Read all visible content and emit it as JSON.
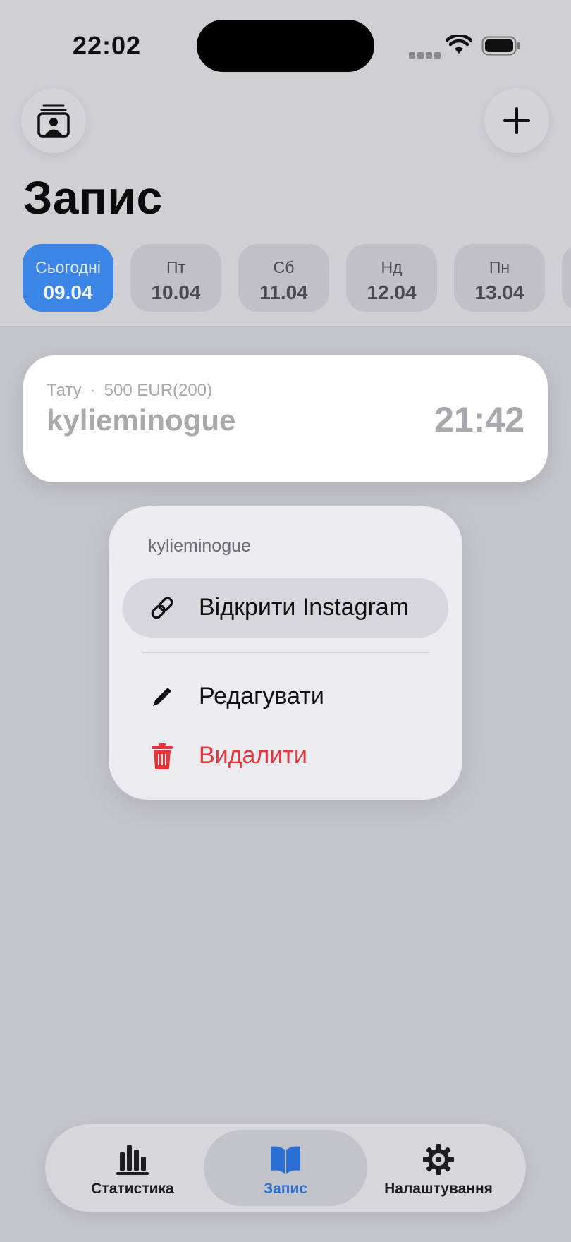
{
  "status_bar": {
    "time": "22:02"
  },
  "header": {
    "title": "Запис",
    "icons": [
      "contacts-icon",
      "plus-icon"
    ]
  },
  "date_chips": [
    {
      "name": "Сьогодні",
      "date": "09.04",
      "active": true
    },
    {
      "name": "Пт",
      "date": "10.04",
      "active": false
    },
    {
      "name": "Сб",
      "date": "11.04",
      "active": false
    },
    {
      "name": "Нд",
      "date": "12.04",
      "active": false
    },
    {
      "name": "Пн",
      "date": "13.04",
      "active": false
    }
  ],
  "entry": {
    "service": "Тату",
    "separator": "·",
    "price": "500 EUR(200)",
    "client": "kylieminogue",
    "time": "21:42"
  },
  "context_menu": {
    "title": "kylieminogue",
    "items": [
      {
        "label": "Відкрити Instagram",
        "icon": "link-icon"
      },
      {
        "label": "Редагувати",
        "icon": "pencil-icon"
      },
      {
        "label": "Видалити",
        "icon": "trash-icon"
      }
    ]
  },
  "tab_bar": {
    "items": [
      {
        "label": "Статистика",
        "icon": "chart-icon"
      },
      {
        "label": "Запис",
        "icon": "book-icon"
      },
      {
        "label": "Налаштування",
        "icon": "gear-icon"
      }
    ],
    "active": "Запис"
  },
  "colors": {
    "accent": "#3a85e6",
    "danger": "#e5353b",
    "tab_active": "#2c6fd4"
  }
}
